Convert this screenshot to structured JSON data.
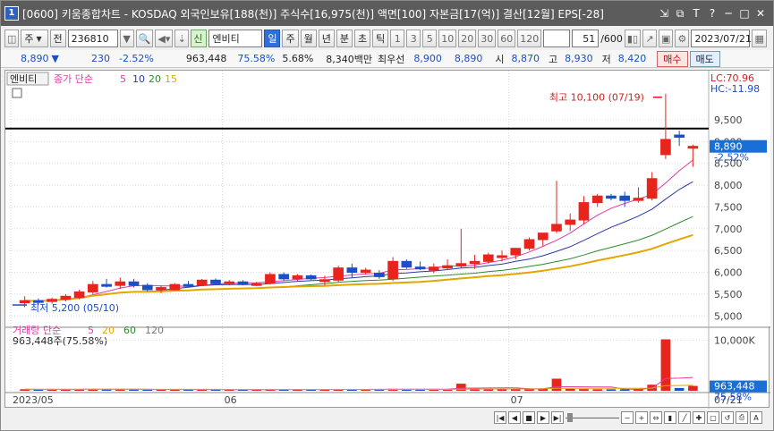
{
  "window": {
    "number_badge": "1",
    "title": "[0600] 키움종합차트 - KOSDAQ 외국인보유[188(천)] 주식수[16,975(천)] 액면[100] 자본금[17(억)] 결산[12월] EPS[-28]",
    "controls": [
      "⇲",
      "⧉",
      "T",
      "?",
      "─",
      "□",
      "✕"
    ]
  },
  "toolbar": {
    "code_prefix_1": "주",
    "code_prefix_2": "전",
    "stock_code": "236810",
    "stock_name": "엔비티",
    "badge_new": "신",
    "period_buttons": [
      "일",
      "주",
      "월",
      "년",
      "분",
      "초",
      "틱"
    ],
    "active_period": "일",
    "interval_buttons": [
      "1",
      "3",
      "5",
      "10",
      "20",
      "30",
      "60",
      "120"
    ],
    "page": "51",
    "page_total": "/600",
    "date": "2023/07/21"
  },
  "quote": {
    "price": "8,890",
    "change_arrow": "▼",
    "change": "230",
    "change_pct": "-2.52%",
    "volume": "963,448",
    "ratio1": "75.58%",
    "ratio2": "5.68%",
    "amount": "8,340백만",
    "best_label": "최우선",
    "best_ask": "8,900",
    "best_bid": "8,890",
    "open_label": "시",
    "open": "8,870",
    "high_label": "고",
    "high": "8,930",
    "low_label": "저",
    "low": "8,420",
    "buy_label": "매수",
    "sell_label": "매도"
  },
  "price_panel": {
    "name_tag": "엔비티",
    "legend_title": "종가 단순",
    "ma_periods": [
      "5",
      "10",
      "20",
      "15"
    ],
    "ma_colors": [
      "#e23aa6",
      "#2a3aa8",
      "#2c8a2c",
      "#e3a600"
    ],
    "lc_label": "LC:70.96",
    "hc_label": "HC:-11.98",
    "high_marker": "최고 10,100 (07/19)",
    "low_marker": "최저 5,200 (05/10)",
    "last_price_tag": "8,890",
    "last_pct_tag": "-2.52%",
    "y_ticks": [
      "9,500",
      "9,000",
      "8,500",
      "8,000",
      "7,500",
      "7,000",
      "6,500",
      "6,000",
      "5,500",
      "5,000"
    ]
  },
  "volume_panel": {
    "legend_title": "거래량 단순",
    "ma_periods": [
      "5",
      "20",
      "60",
      "120"
    ],
    "ma_colors": [
      "#e23aa6",
      "#e3a600",
      "#2c8a2c",
      "#777777"
    ],
    "summary": "963,448주(75.58%)",
    "y_tick": "10,000K",
    "last_tag": "963,448",
    "last_pct": "75.58%"
  },
  "x_axis": {
    "labels": [
      "2023/05",
      "06",
      "07"
    ],
    "right_label": "07/21"
  },
  "chart_data": {
    "type": "candlestick",
    "title": "엔비티",
    "ylim": [
      4800,
      10300
    ],
    "y_unit": "KRW",
    "candles": [
      {
        "o": 5300,
        "h": 5450,
        "l": 5200,
        "c": 5350
      },
      {
        "o": 5350,
        "h": 5400,
        "l": 5250,
        "c": 5330
      },
      {
        "o": 5330,
        "h": 5420,
        "l": 5280,
        "c": 5380
      },
      {
        "o": 5380,
        "h": 5500,
        "l": 5330,
        "c": 5450
      },
      {
        "o": 5420,
        "h": 5600,
        "l": 5380,
        "c": 5550
      },
      {
        "o": 5550,
        "h": 5800,
        "l": 5500,
        "c": 5720
      },
      {
        "o": 5720,
        "h": 5850,
        "l": 5650,
        "c": 5700
      },
      {
        "o": 5700,
        "h": 5880,
        "l": 5620,
        "c": 5780
      },
      {
        "o": 5780,
        "h": 5850,
        "l": 5650,
        "c": 5700
      },
      {
        "o": 5700,
        "h": 5750,
        "l": 5560,
        "c": 5600
      },
      {
        "o": 5600,
        "h": 5700,
        "l": 5520,
        "c": 5650
      },
      {
        "o": 5600,
        "h": 5750,
        "l": 5580,
        "c": 5720
      },
      {
        "o": 5720,
        "h": 5800,
        "l": 5660,
        "c": 5700
      },
      {
        "o": 5700,
        "h": 5850,
        "l": 5680,
        "c": 5820
      },
      {
        "o": 5820,
        "h": 5860,
        "l": 5700,
        "c": 5740
      },
      {
        "o": 5740,
        "h": 5820,
        "l": 5700,
        "c": 5780
      },
      {
        "o": 5780,
        "h": 5820,
        "l": 5700,
        "c": 5720
      },
      {
        "o": 5720,
        "h": 5780,
        "l": 5680,
        "c": 5740
      },
      {
        "o": 5750,
        "h": 6000,
        "l": 5720,
        "c": 5950
      },
      {
        "o": 5950,
        "h": 6000,
        "l": 5800,
        "c": 5850
      },
      {
        "o": 5850,
        "h": 5960,
        "l": 5800,
        "c": 5920
      },
      {
        "o": 5920,
        "h": 5950,
        "l": 5820,
        "c": 5850
      },
      {
        "o": 5800,
        "h": 5920,
        "l": 5700,
        "c": 5830
      },
      {
        "o": 5820,
        "h": 6150,
        "l": 5780,
        "c": 6100
      },
      {
        "o": 6100,
        "h": 6200,
        "l": 5880,
        "c": 6000
      },
      {
        "o": 6000,
        "h": 6100,
        "l": 5950,
        "c": 6050
      },
      {
        "o": 5980,
        "h": 6050,
        "l": 5850,
        "c": 5900
      },
      {
        "o": 5850,
        "h": 6350,
        "l": 5800,
        "c": 6250
      },
      {
        "o": 6250,
        "h": 6300,
        "l": 6080,
        "c": 6120
      },
      {
        "o": 6120,
        "h": 6250,
        "l": 6050,
        "c": 6100
      },
      {
        "o": 6050,
        "h": 6200,
        "l": 5980,
        "c": 6120
      },
      {
        "o": 6100,
        "h": 6300,
        "l": 6050,
        "c": 6150
      },
      {
        "o": 6150,
        "h": 7000,
        "l": 6100,
        "c": 6200
      },
      {
        "o": 6200,
        "h": 6400,
        "l": 6080,
        "c": 6250
      },
      {
        "o": 6250,
        "h": 6450,
        "l": 6200,
        "c": 6400
      },
      {
        "o": 6350,
        "h": 6500,
        "l": 6250,
        "c": 6380
      },
      {
        "o": 6400,
        "h": 6550,
        "l": 6300,
        "c": 6550
      },
      {
        "o": 6550,
        "h": 6800,
        "l": 6500,
        "c": 6750
      },
      {
        "o": 6750,
        "h": 6900,
        "l": 6600,
        "c": 6900
      },
      {
        "o": 6950,
        "h": 8100,
        "l": 6900,
        "c": 7100
      },
      {
        "o": 7100,
        "h": 7350,
        "l": 6950,
        "c": 7200
      },
      {
        "o": 7200,
        "h": 7750,
        "l": 7100,
        "c": 7600
      },
      {
        "o": 7600,
        "h": 7800,
        "l": 7500,
        "c": 7750
      },
      {
        "o": 7750,
        "h": 7800,
        "l": 7650,
        "c": 7700
      },
      {
        "o": 7750,
        "h": 7850,
        "l": 7500,
        "c": 7650
      },
      {
        "o": 7650,
        "h": 7950,
        "l": 7600,
        "c": 7700
      },
      {
        "o": 7700,
        "h": 8300,
        "l": 7650,
        "c": 8150
      },
      {
        "o": 8700,
        "h": 10100,
        "l": 8600,
        "c": 9050
      },
      {
        "o": 9150,
        "h": 9250,
        "l": 8900,
        "c": 9100
      },
      {
        "o": 8870,
        "h": 8930,
        "l": 8420,
        "c": 8890
      }
    ],
    "volume_k": [
      300,
      280,
      260,
      300,
      320,
      350,
      300,
      310,
      260,
      240,
      230,
      250,
      240,
      270,
      240,
      220,
      210,
      220,
      300,
      260,
      240,
      220,
      230,
      350,
      280,
      270,
      260,
      380,
      300,
      280,
      290,
      300,
      1400,
      400,
      380,
      350,
      360,
      420,
      400,
      2400,
      380,
      330,
      300,
      290,
      280,
      300,
      1200,
      10200,
      550,
      963
    ]
  }
}
